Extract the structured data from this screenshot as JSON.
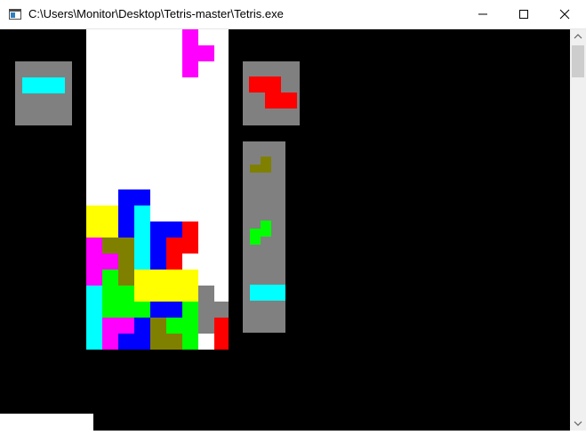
{
  "window": {
    "title": "C:\\Users\\Monitor\\Desktop\\Tetris-master\\Tetris.exe",
    "icon": "console-app-icon",
    "buttons": [
      "minimize-icon",
      "maximize-icon",
      "close-icon"
    ]
  },
  "colors": {
    "background": "#000000",
    "board": "#ffffff",
    "panel": "#808080",
    "pieces": {
      "I": "#00ffff",
      "O": "#ffff00",
      "T": "#ff00ff",
      "S": "#00ff00",
      "Z": "#ff0000",
      "J": "#0000ff",
      "L": "#808000",
      "G": "#808080"
    }
  },
  "game": {
    "grid": {
      "columns": 9,
      "visible_rows": 20
    },
    "falling_piece": {
      "type": "T",
      "cells": [
        [
          6,
          0
        ],
        [
          6,
          1
        ],
        [
          7,
          1
        ],
        [
          6,
          2
        ]
      ]
    },
    "board_rows": [
      ".........",
      ".........",
      ".........",
      ".........",
      ".........",
      ".........",
      ".........",
      ".........",
      ".........",
      ".........",
      "..JJ.....",
      "OOJI.....",
      "OOJIJJZ..",
      "TLLIJZZ..",
      "TTLIJZ...",
      "TSLOOOO..",
      "ISSOOOOG.",
      "ISSSJJSGGZ",
      "ITTJLSSGZZ",
      "ITJJLLS.Z."
    ],
    "hold": {
      "type": "I",
      "cells": [
        [
          0,
          0
        ],
        [
          1,
          0
        ],
        [
          2,
          0
        ],
        [
          3,
          0
        ]
      ]
    },
    "next": {
      "type": "Z",
      "cells": [
        [
          0,
          0
        ],
        [
          1,
          0
        ],
        [
          1,
          1
        ],
        [
          2,
          1
        ]
      ]
    },
    "queue": [
      {
        "type": "L",
        "cells": [
          [
            1,
            0
          ],
          [
            1,
            1
          ],
          [
            0,
            1
          ],
          [
            1,
            0
          ]
        ]
      },
      {
        "type": "S",
        "cells": [
          [
            1,
            0
          ],
          [
            0,
            1
          ],
          [
            1,
            1
          ],
          [
            0,
            2
          ]
        ]
      },
      {
        "type": "I",
        "cells": [
          [
            0,
            0
          ],
          [
            1,
            0
          ],
          [
            2,
            0
          ]
        ]
      }
    ]
  }
}
